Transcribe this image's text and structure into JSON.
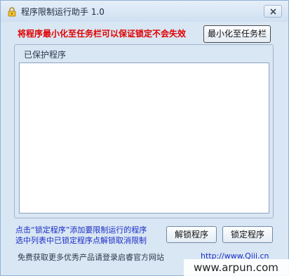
{
  "window": {
    "title": "程序限制运行助手 1.0",
    "warning": "将程序最小化至任务栏可以保证锁定不会失效",
    "minimize_button": "最小化至任务栏",
    "group_label": "已保护程序",
    "protected_programs": [],
    "hint_line_1": "点击“锁定程序”添加要限制运行的程序",
    "hint_line_2": "选中列表中已锁定程序点解锁取消限制",
    "unlock_button": "解锁程序",
    "lock_button": "锁定程序",
    "footer_text": "免费获取更多优秀产品请登录启睿官方网站",
    "footer_link": "http://www.Qiii.cn"
  },
  "watermark": {
    "text": "www.arpun.com"
  },
  "icons": {
    "app": "padlock-icon",
    "close": "close-icon"
  },
  "colors": {
    "warning": "#e00000",
    "hint": "#1a2ec8",
    "window_bg": "#d9e6f3",
    "titlebar": "#cfe0f1"
  }
}
